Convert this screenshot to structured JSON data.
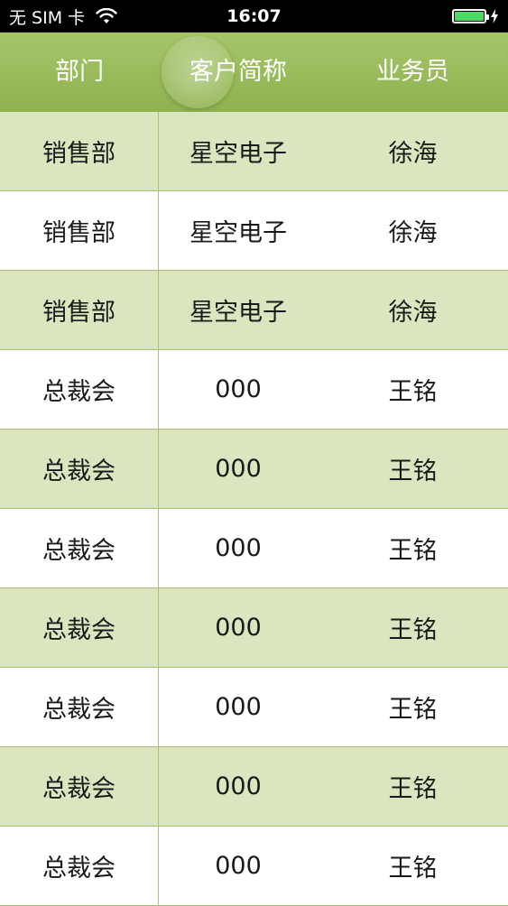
{
  "status_bar": {
    "carrier": "无 SIM 卡",
    "time": "16:07",
    "wifi_icon": "wifi-icon",
    "battery_icon": "battery-icon",
    "charging_icon": "charging-bolt-icon",
    "battery_level": 1.0,
    "battery_color": "#4cd964"
  },
  "table": {
    "header_color": "#96b85a",
    "stripe_color": "#d9e6bf",
    "columns": [
      "部门",
      "客户简称",
      "业务员"
    ],
    "rows": [
      [
        "销售部",
        "星空电子",
        "徐海"
      ],
      [
        "销售部",
        "星空电子",
        "徐海"
      ],
      [
        "销售部",
        "星空电子",
        "徐海"
      ],
      [
        "总裁会",
        "000",
        "王铭"
      ],
      [
        "总裁会",
        "000",
        "王铭"
      ],
      [
        "总裁会",
        "000",
        "王铭"
      ],
      [
        "总裁会",
        "000",
        "王铭"
      ],
      [
        "总裁会",
        "000",
        "王铭"
      ],
      [
        "总裁会",
        "000",
        "王铭"
      ],
      [
        "总裁会",
        "000",
        "王铭"
      ]
    ]
  }
}
